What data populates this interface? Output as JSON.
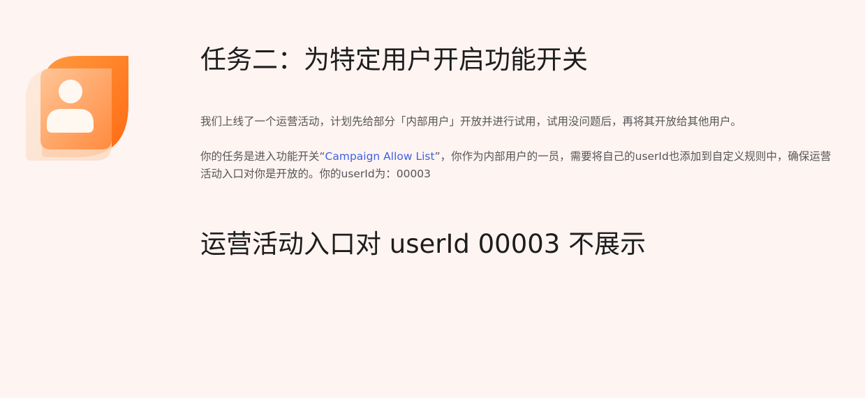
{
  "logo": {
    "icon": "user-avatar-icon",
    "colors": {
      "primary": "#ff7a1f",
      "secondary": "#ffb27a",
      "back": "#fde3d0"
    }
  },
  "task": {
    "title": "任务二：为特定用户开启功能开关",
    "intro": "我们上线了一个运营活动，计划先给部分「内部用户」开放并进行试用，试用没问题后，再将其开放给其他用户。",
    "instr_before": "你的任务是进入功能开关“",
    "instr_link": "Campaign Allow List",
    "instr_after": "”，你作为内部用户的一员，需要将自己的userId也添加到自定义规则中，确保运营活动入口对你是开放的。你的userId为：00003"
  },
  "status": {
    "text": "运营活动入口对 userId 00003 不展示"
  },
  "colors": {
    "background": "#fef4f2",
    "link": "#3d63e2",
    "title": "#1d1d1d",
    "body_text": "#555555"
  }
}
